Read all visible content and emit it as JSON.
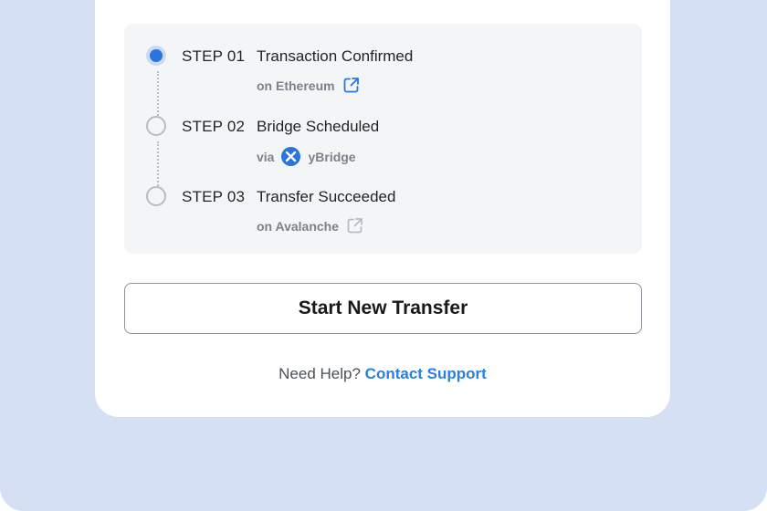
{
  "steps": [
    {
      "number": "STEP 01",
      "title": "Transaction Confirmed",
      "subtitle": "on Ethereum",
      "status": "active",
      "icon": "external-link-icon",
      "icon_color": "#2a74e0"
    },
    {
      "number": "STEP 02",
      "title": "Bridge Scheduled",
      "subtitle_prefix": "via",
      "subtitle": "yBridge",
      "status": "pending",
      "icon": "ybridge-logo-icon"
    },
    {
      "number": "STEP 03",
      "title": "Transfer Succeeded",
      "subtitle": "on Avalanche",
      "status": "pending",
      "icon": "external-link-icon",
      "icon_color": "#b7bcc4"
    }
  ],
  "primary_button": {
    "label": "Start New Transfer"
  },
  "help": {
    "prompt": "Need Help?",
    "link_label": "Contact Support"
  },
  "colors": {
    "background": "#d5e0f4",
    "accent": "#2a74e0",
    "link": "#2a7fdf",
    "panel": "#f4f5f7"
  }
}
